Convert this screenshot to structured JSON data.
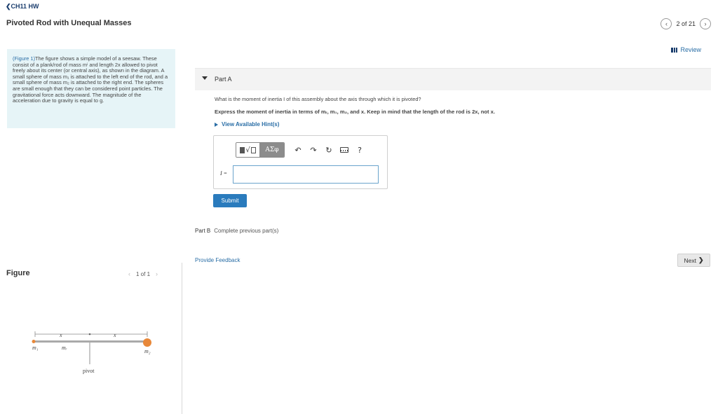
{
  "header": {
    "back_label": "CH11 HW",
    "title": "Pivoted Rod with Unequal Masses"
  },
  "pager": {
    "text": "2 of 21"
  },
  "review": {
    "label": "Review"
  },
  "description": {
    "figure_link": "(Figure 1)",
    "text": "The figure shows a simple model of a seesaw. These consist of a plank/rod of mass mⁱ and length 2x allowed to pivot freely about its center (or central axis), as shown in the diagram. A small sphere of mass m₁ is attached to the left end of the rod, and a small sphere of mass m₂ is attached to the right end. The spheres are small enough that they can be considered point particles. The gravitational force acts downward. The magnitude of the acceleration due to gravity is equal to g."
  },
  "figure_panel": {
    "label": "Figure",
    "pager_text": "1 of 1",
    "diagram": {
      "x_label_left": "x",
      "x_label_right": "x",
      "m1_label": "m₁",
      "mr_label": "mᵣ",
      "m2_label": "m₂",
      "pivot_label": "pivot"
    }
  },
  "partA": {
    "label": "Part A",
    "question": "What is the moment of inertia I of this assembly about the axis through which it is pivoted?",
    "instruction": "Express the moment of inertia in terms of mᵣ, m₁, m₂, and x. Keep in mind that the length of the rod is 2x, not x.",
    "hints_label": "View Available Hint(s)",
    "toolbar": {
      "greek_label": "AΣφ",
      "undo_icon": "undo-icon",
      "redo_icon": "redo-icon",
      "reset_icon": "reset-icon",
      "keyboard_icon": "keyboard-icon",
      "help_label": "?"
    },
    "input_label": "I =",
    "input_value": "",
    "submit_label": "Submit"
  },
  "partB": {
    "label": "Part B",
    "status": "Complete previous part(s)"
  },
  "footer": {
    "feedback_label": "Provide Feedback",
    "next_label": "Next"
  },
  "colors": {
    "link_blue": "#2a6ea6",
    "submit_blue": "#2a7bbd",
    "desc_bg": "#e6f4f7",
    "sphere_orange": "#e8883a"
  }
}
